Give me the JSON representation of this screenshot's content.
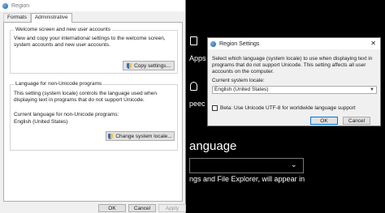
{
  "background": {
    "apps_text": "Apps",
    "speech_text": "peec",
    "language_heading": "anguage",
    "file_explorer_text": "ngs and File Explorer, will appear in"
  },
  "region_dialog": {
    "title": "Region",
    "tabs": [
      "Formats",
      "Administrative"
    ],
    "welcome_group": {
      "title": "Welcome screen and new user accounts",
      "description": "View and copy your international settings to the welcome screen, system accounts and new user accounts.",
      "button_label": "Copy settings..."
    },
    "unicode_group": {
      "title": "Language for non-Unicode programs",
      "description": "This setting (system locale) controls the language used when displaying text in programs that do not support Unicode.",
      "current_label": "Current language for non-Unicode programs:",
      "current_value": "English (United States)",
      "button_label": "Change system locale..."
    },
    "ok_label": "OK",
    "cancel_label": "Cancel",
    "apply_label": "Apply"
  },
  "region_settings_dialog": {
    "title": "Region Settings",
    "close_glyph": "✕",
    "description": "Select which language (system locale) to use when displaying text in programs that do not support Unicode. This setting affects all user accounts on the computer.",
    "locale_label": "Current system locale:",
    "locale_value": "English (United States)",
    "beta_label": "Beta: Use Unicode UTF-8 for worldwide language support",
    "beta_checked": false,
    "ok_label": "OK",
    "cancel_label": "Cancel"
  }
}
